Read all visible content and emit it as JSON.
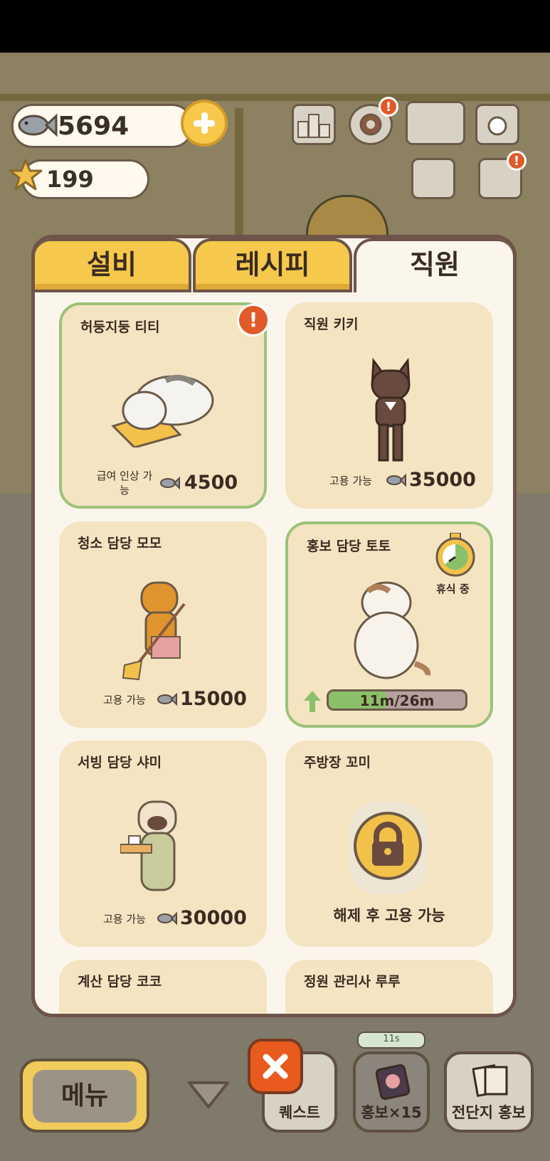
{
  "hud": {
    "fish_count": "5694",
    "star_count": "199"
  },
  "tabs": [
    {
      "label": "설비",
      "active": false
    },
    {
      "label": "레시피",
      "active": false
    },
    {
      "label": "직원",
      "active": true
    }
  ],
  "staff": [
    {
      "name": "허둥지둥 티티",
      "status": "급여 인상 가능",
      "price": "4500",
      "selected": true,
      "alert": true
    },
    {
      "name": "직원 키키",
      "status": "고용 가능",
      "price": "35000"
    },
    {
      "name": "청소 담당 모모",
      "status": "고용 가능",
      "price": "15000"
    },
    {
      "name": "홍보 담당 토토",
      "badge": "휴식 중",
      "progress_text": "11m/26m",
      "progress": 0.42,
      "selected": true
    },
    {
      "name": "서빙 담당 샤미",
      "status": "고용 가능",
      "price": "30000"
    },
    {
      "name": "주방장 꼬미",
      "locked_text": "해제 후 고용 가능"
    },
    {
      "name": "계산 담당 코코"
    },
    {
      "name": "정원 관리사 루루"
    }
  ],
  "bottom": {
    "menu_label": "메뉴",
    "quest_label": "퀘스트",
    "promo_label": "홍보×15",
    "flyer_label": "전단지 홍보",
    "timer_text": "11s"
  },
  "colors": {
    "accent_yellow": "#f6c84c",
    "panel_bg": "#fbf6ec",
    "card_bg": "#f4e4c2",
    "selected_border": "#9cc27a",
    "alert_orange": "#e05a2a"
  }
}
